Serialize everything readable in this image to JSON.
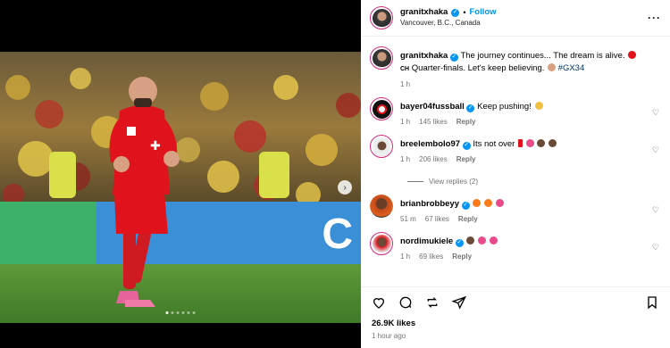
{
  "post": {
    "author": "granitxhaka",
    "follow_sep": "•",
    "follow_label": "Follow",
    "location": "Vancouver, B.C., Canada",
    "more_label": "···"
  },
  "caption": {
    "user": "granitxhaka",
    "text": "The journey continues... The dream is alive.",
    "text2": "Quarter-finals. Let's keep believing.",
    "flag_text": "CH",
    "hashtag": "#GX34",
    "time": "1 h"
  },
  "comments": [
    {
      "user": "bayer04fussball",
      "text": "Keep pushing!",
      "time": "1 h",
      "likes": "145 likes",
      "reply": "Reply"
    },
    {
      "user": "breelembolo97",
      "text": "Its not over",
      "time": "1 h",
      "likes": "206 likes",
      "reply": "Reply"
    },
    {
      "user": "brianbrobbeyy",
      "text": "",
      "time": "51 m",
      "likes": "67 likes",
      "reply": "Reply"
    },
    {
      "user": "nordimukiele",
      "text": "",
      "time": "1 h",
      "likes": "69 likes",
      "reply": "Reply"
    }
  ],
  "view_replies": "View replies (2)",
  "stats": {
    "likes": "26.9K likes",
    "ago": "1 hour ago"
  },
  "carousel": {
    "count": 6,
    "active_index": 0
  },
  "colors": {
    "accent": "#0095f6",
    "ring": "#d6297b",
    "jersey": "#e0121b"
  },
  "icons": [
    "verified-icon",
    "more-icon",
    "heart-icon",
    "comment-icon",
    "repost-icon",
    "share-icon",
    "bookmark-icon",
    "chevron-right-icon"
  ]
}
